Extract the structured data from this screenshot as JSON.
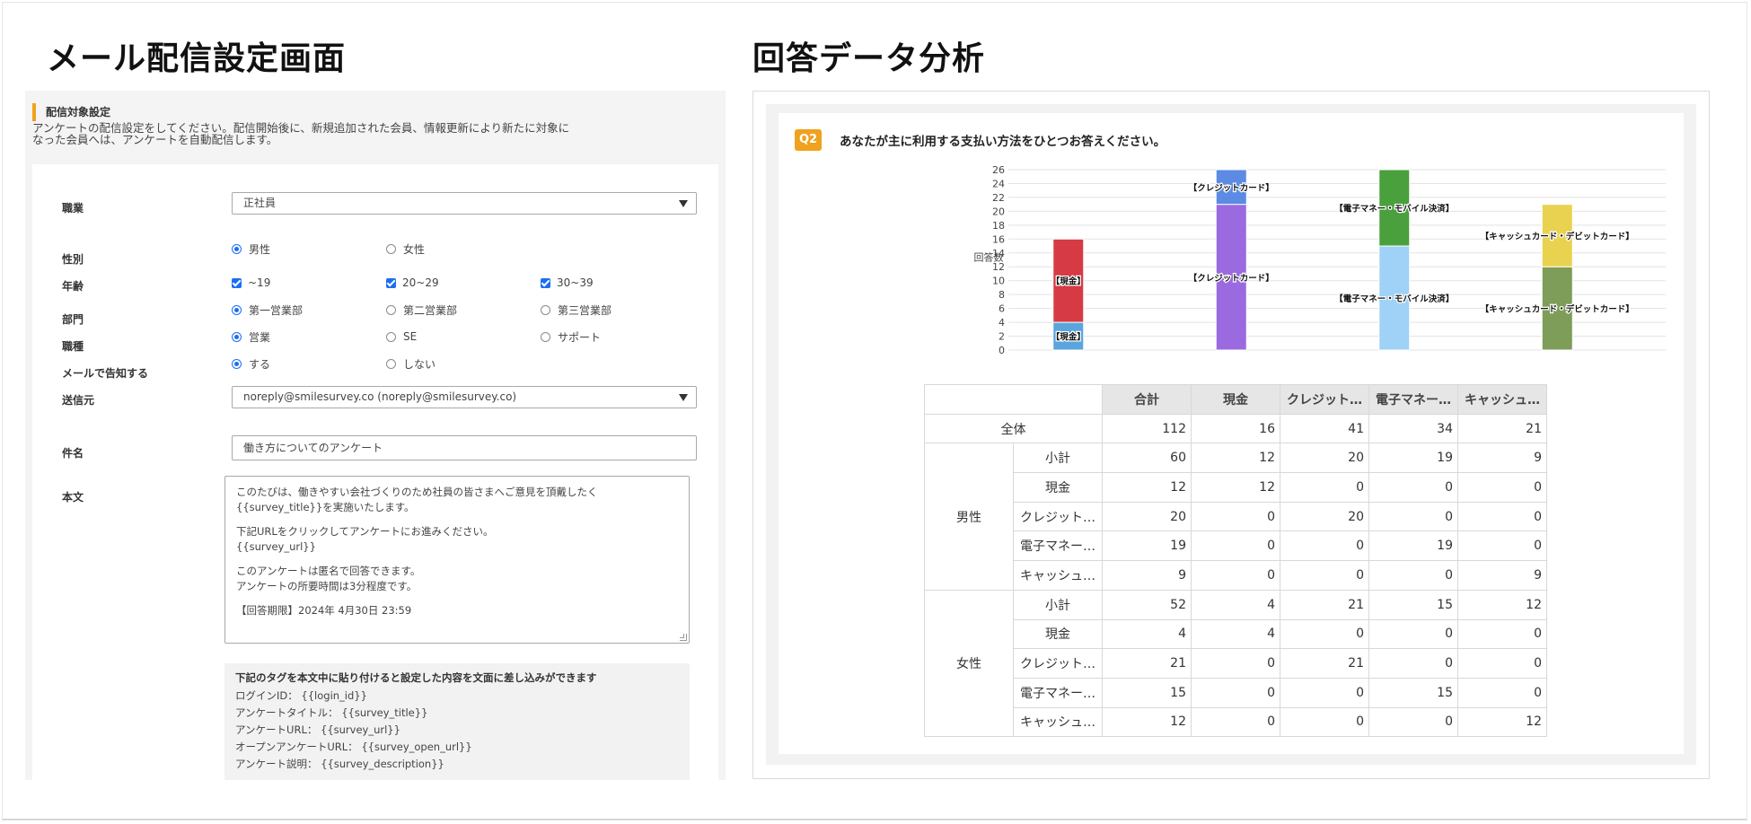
{
  "left": {
    "title": "メール配信設定画面",
    "section_title": "配信対象設定",
    "section_desc": "アンケートの配信設定をしてください。配信開始後に、新規追加された会員、情報更新により新たに対象になった会員へは、アンケートを自動配信します。",
    "form": {
      "shokugyo": {
        "label": "職業",
        "value": "正社員"
      },
      "gender": {
        "label": "性別",
        "options": [
          "男性",
          "女性"
        ],
        "selected": 0
      },
      "age": {
        "label": "年齢",
        "options": [
          "~19",
          "20~29",
          "30~39"
        ],
        "checked": [
          true,
          true,
          true
        ]
      },
      "dept": {
        "label": "部門",
        "options": [
          "第一営業部",
          "第二営業部",
          "第三営業部"
        ],
        "selected": 0
      },
      "jobtype": {
        "label": "職種",
        "options": [
          "営業",
          "SE",
          "サポート"
        ],
        "selected": 0
      },
      "notify": {
        "label": "メールで告知する",
        "options": [
          "する",
          "しない"
        ],
        "selected": 0
      },
      "sender": {
        "label": "送信元",
        "value": "noreply@smilesurvey.co (noreply@smilesurvey.co)"
      },
      "subject": {
        "label": "件名",
        "value": "働き方についてのアンケート"
      },
      "body": {
        "label": "本文",
        "lines": [
          "このたびは、働きやすい会社づくりのため社員の皆さまへご意見を頂戴したく",
          "{{survey_title}}を実施いたします。",
          "下記URLをクリックしてアンケートにお進みください。",
          "{{survey_url}}",
          "このアンケートは匿名で回答できます。",
          "アンケートの所要時間は3分程度です。",
          "【回答期限】2024年 4月30日 23:59"
        ]
      },
      "tags": {
        "title": "下記のタグを本文中に貼り付けると設定した内容を文面に差し込みができます",
        "lines": [
          "ログインID： {{login_id}}",
          "アンケートタイトル： {{survey_title}}",
          "アンケートURL： {{survey_url}}",
          "オープンアンケートURL： {{survey_open_url}}",
          "アンケート説明： {{survey_description}}"
        ]
      }
    }
  },
  "right": {
    "title": "回答データ分析",
    "q_badge": "Q2",
    "question": "あなたが主に利用する支払い方法をひとつお答えください。",
    "table": {
      "headers": [
        "合計",
        "現金",
        "クレジット…",
        "電子マネー…",
        "キャッシュ…"
      ],
      "total_label": "全体",
      "total_row": [
        "112",
        "16",
        "41",
        "34",
        "21"
      ],
      "groups": [
        {
          "name": "男性",
          "rows": [
            {
              "label": "小計",
              "values": [
                "60",
                "12",
                "20",
                "19",
                "9"
              ]
            },
            {
              "label": "現金",
              "values": [
                "12",
                "12",
                "0",
                "0",
                "0"
              ]
            },
            {
              "label": "クレジット…",
              "values": [
                "20",
                "0",
                "20",
                "0",
                "0"
              ]
            },
            {
              "label": "電子マネー…",
              "values": [
                "19",
                "0",
                "0",
                "19",
                "0"
              ]
            },
            {
              "label": "キャッシュ…",
              "values": [
                "9",
                "0",
                "0",
                "0",
                "9"
              ]
            }
          ]
        },
        {
          "name": "女性",
          "rows": [
            {
              "label": "小計",
              "values": [
                "52",
                "4",
                "21",
                "15",
                "12"
              ]
            },
            {
              "label": "現金",
              "values": [
                "4",
                "4",
                "0",
                "0",
                "0"
              ]
            },
            {
              "label": "クレジット…",
              "values": [
                "21",
                "0",
                "21",
                "0",
                "0"
              ]
            },
            {
              "label": "電子マネー…",
              "values": [
                "15",
                "0",
                "0",
                "15",
                "0"
              ]
            },
            {
              "label": "キャッシュ…",
              "values": [
                "12",
                "0",
                "0",
                "0",
                "12"
              ]
            }
          ]
        }
      ]
    }
  },
  "chart_data": {
    "type": "bar",
    "stacked": true,
    "ylabel": "回答数",
    "ylim": [
      0,
      26
    ],
    "yticks": [
      0,
      2,
      4,
      6,
      8,
      10,
      12,
      14,
      16,
      18,
      20,
      22,
      24,
      26
    ],
    "grid": true,
    "bars": [
      {
        "segments": [
          {
            "label": "【現金】",
            "value": 4,
            "color": "#5aa5dd"
          },
          {
            "label": "【現金】",
            "value": 12,
            "color": "#d63b45"
          }
        ]
      },
      {
        "segments": [
          {
            "label": "【クレジットカード】",
            "value": 21,
            "color": "#9b6ae0"
          },
          {
            "label": "【クレジットカード】",
            "value": 5,
            "color": "#5b8be3"
          }
        ]
      },
      {
        "segments": [
          {
            "label": "【電子マネー・モバイル決済】",
            "value": 15,
            "color": "#9fd2f6"
          },
          {
            "label": "【電子マネー・モバイル決済】",
            "value": 11,
            "color": "#4aa03c"
          }
        ]
      },
      {
        "segments": [
          {
            "label": "【キャッシュカード・デビットカード】",
            "value": 12,
            "color": "#7d9d58"
          },
          {
            "label": "【キャッシュカード・デビットカード】",
            "value": 9,
            "color": "#e9d24f"
          }
        ]
      }
    ]
  }
}
